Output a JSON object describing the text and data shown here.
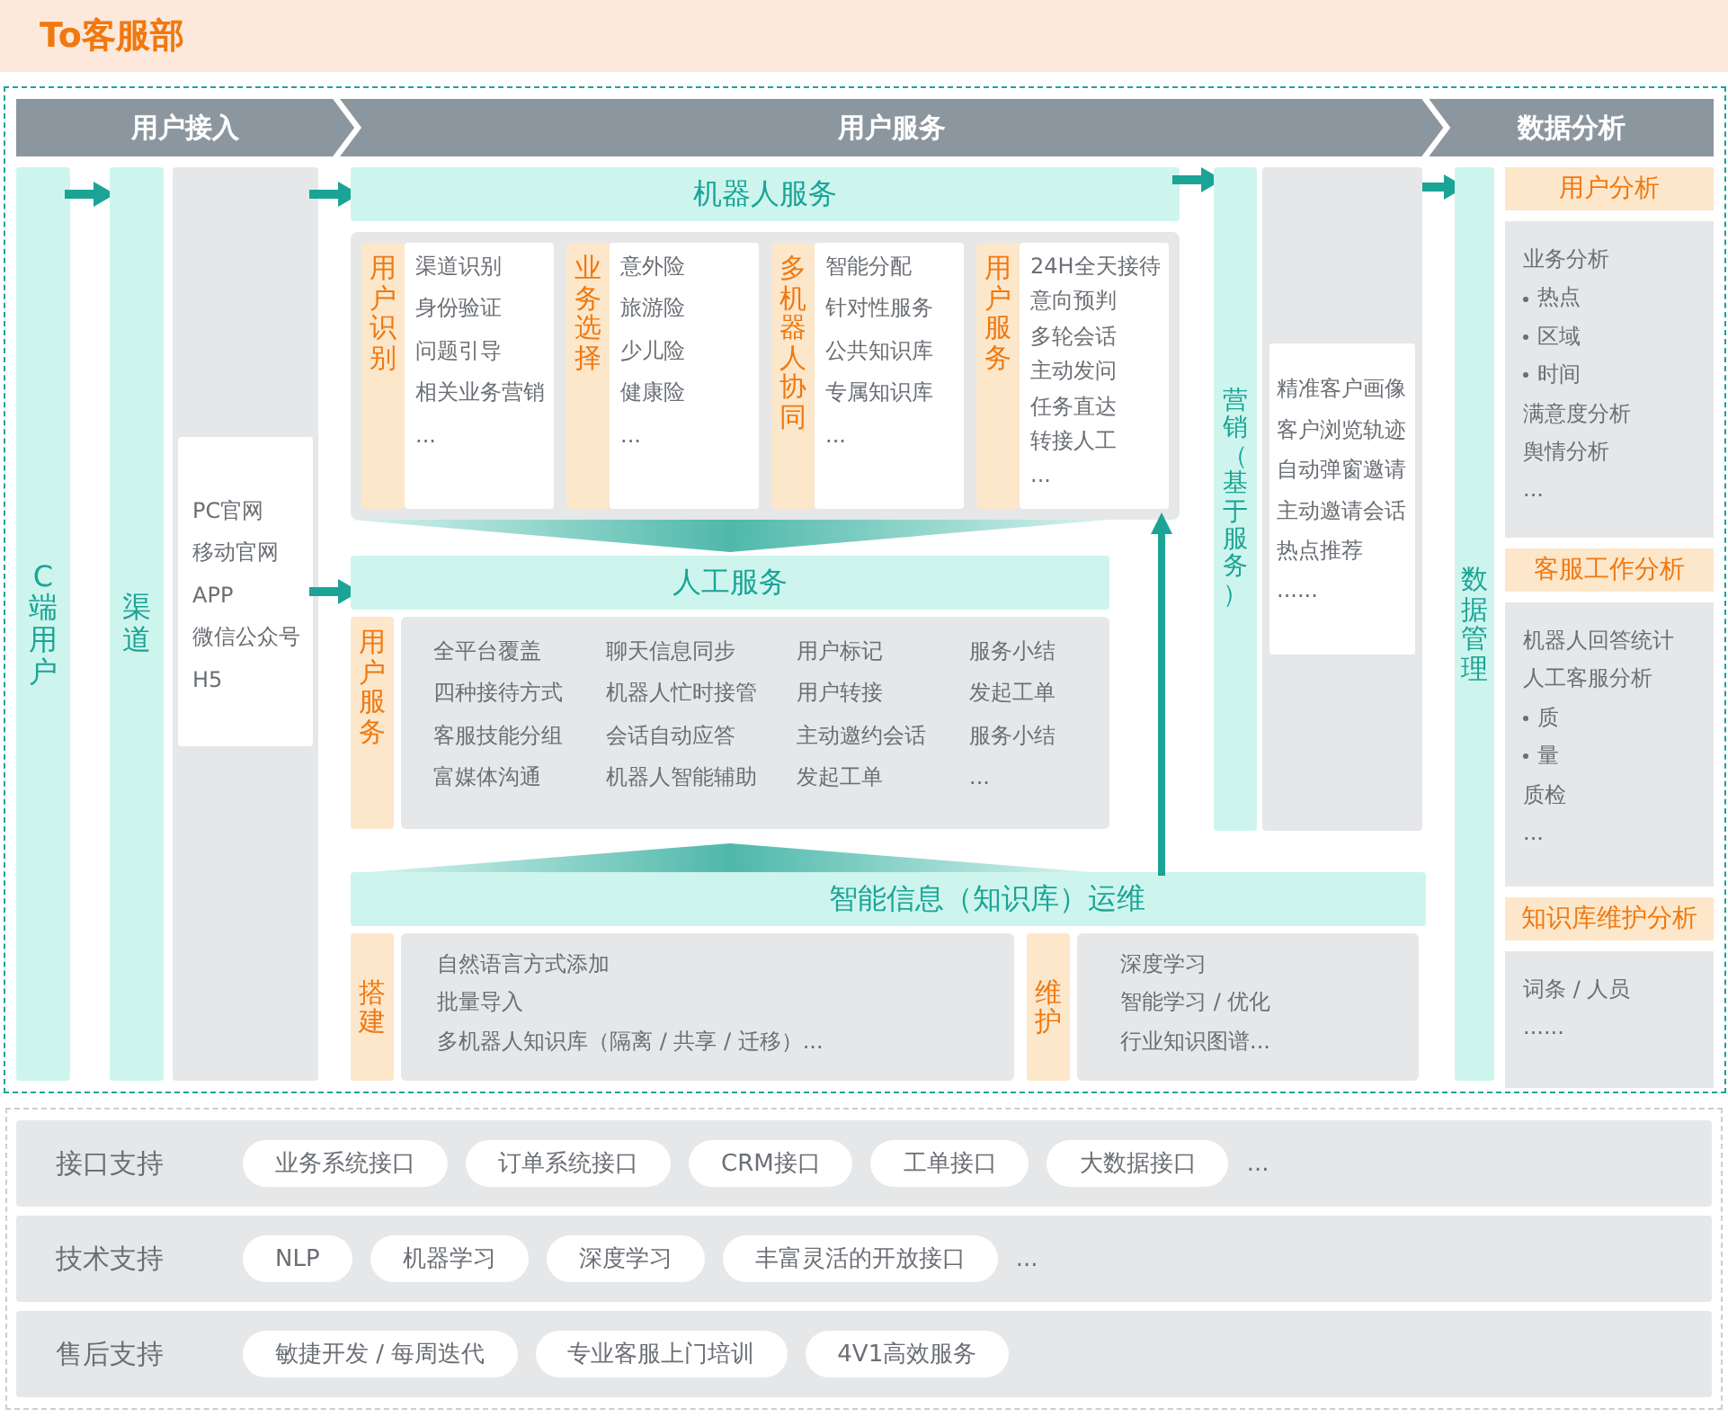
{
  "header": {
    "title": "To客服部"
  },
  "phases": [
    {
      "label": "用户接入"
    },
    {
      "label": "用户服务"
    },
    {
      "label": "数据分析"
    }
  ],
  "access": {
    "user_column": "C端用户",
    "channel_column": "渠道",
    "channels": [
      "PC官网",
      "移动官网",
      "APP",
      "微信公众号",
      "H5"
    ]
  },
  "robot_service": {
    "title": "机器人服务",
    "groups": [
      {
        "label": "用户识别",
        "items": [
          "渠道识别",
          "身份验证",
          "问题引导",
          "相关业务营销",
          "..."
        ]
      },
      {
        "label": "业务选择",
        "items": [
          "意外险",
          "旅游险",
          "少儿险",
          "健康险",
          "..."
        ]
      },
      {
        "label": "多机器人协同",
        "items": [
          "智能分配",
          "针对性服务",
          "公共知识库",
          "专属知识库",
          "..."
        ]
      },
      {
        "label": "用户服务",
        "items": [
          "24H全天接待",
          "意向预判",
          "多轮会话",
          "主动发问",
          "任务直达",
          "转接人工",
          "..."
        ]
      }
    ]
  },
  "manual_service": {
    "title": "人工服务",
    "label": "用户服务",
    "items": [
      "全平台覆盖",
      "聊天信息同步",
      "用户标记",
      "服务小结",
      "四种接待方式",
      "机器人忙时接管",
      "用户转接",
      "发起工单",
      "客服技能分组",
      "会话自动应答",
      "主动邀约会话",
      "服务小结",
      "富媒体沟通",
      "机器人智能辅助",
      "发起工单",
      "..."
    ]
  },
  "knowledge_ops": {
    "title": "智能信息（知识库）运维",
    "sections": [
      {
        "label": "搭建",
        "items": [
          "自然语言方式添加",
          "批量导入",
          "多机器人知识库（隔离 / 共享 / 迁移）..."
        ]
      },
      {
        "label": "维护",
        "items": [
          "深度学习",
          "智能学习 / 优化",
          "行业知识图谱..."
        ]
      }
    ]
  },
  "marketing": {
    "title": "营销（基于服务）",
    "items": [
      "精准客户画像",
      "客户浏览轨迹",
      "自动弹窗邀请",
      "主动邀请会话",
      "热点推荐",
      "......"
    ]
  },
  "data_analysis": {
    "column": "数据管理",
    "sections": [
      {
        "title": "用户分析",
        "items": [
          {
            "text": "业务分析",
            "kind": "plain"
          },
          {
            "text": "热点",
            "kind": "bullet"
          },
          {
            "text": "区域",
            "kind": "bullet"
          },
          {
            "text": "时间",
            "kind": "bullet"
          },
          {
            "text": "满意度分析",
            "kind": "plain"
          },
          {
            "text": "舆情分析",
            "kind": "plain"
          },
          {
            "text": "...",
            "kind": "plain"
          }
        ]
      },
      {
        "title": "客服工作分析",
        "items": [
          {
            "text": "机器人回答统计",
            "kind": "plain"
          },
          {
            "text": "人工客服分析",
            "kind": "plain"
          },
          {
            "text": "质",
            "kind": "bullet"
          },
          {
            "text": "量",
            "kind": "bullet"
          },
          {
            "text": "质检",
            "kind": "plain"
          },
          {
            "text": "...",
            "kind": "plain"
          }
        ]
      },
      {
        "title": "知识库维护分析",
        "items": [
          {
            "text": "词条 / 人员",
            "kind": "plain"
          },
          {
            "text": "......",
            "kind": "plain"
          }
        ]
      }
    ]
  },
  "support": [
    {
      "label": "接口支持",
      "tags": [
        "业务系统接口",
        "订单系统接口",
        "CRM接口",
        "工单接口",
        "大数据接口"
      ],
      "more": "..."
    },
    {
      "label": "技术支持",
      "tags": [
        "NLP",
        "机器学习",
        "深度学习",
        "丰富灵活的开放接口"
      ],
      "more": "..."
    },
    {
      "label": "售后支持",
      "tags": [
        "敏捷开发 / 每周迭代",
        "专业客服上门培训",
        "4V1高效服务"
      ]
    }
  ]
}
